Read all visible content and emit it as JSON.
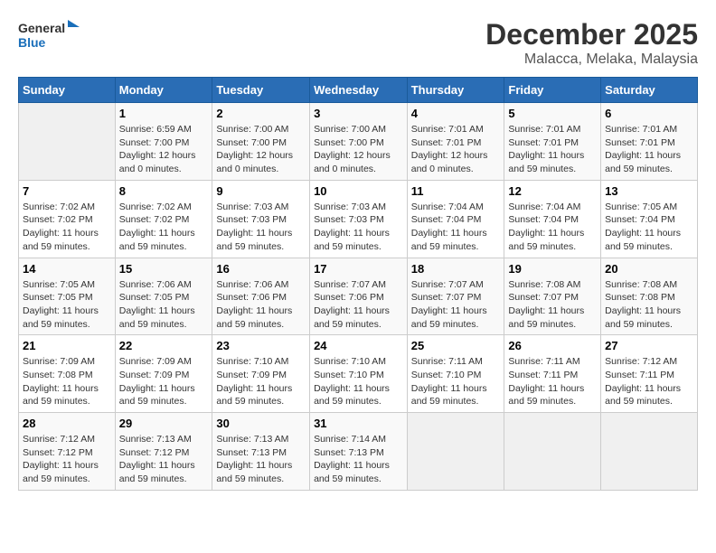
{
  "header": {
    "logo_general": "General",
    "logo_blue": "Blue",
    "title": "December 2025",
    "subtitle": "Malacca, Melaka, Malaysia"
  },
  "days_of_week": [
    "Sunday",
    "Monday",
    "Tuesday",
    "Wednesday",
    "Thursday",
    "Friday",
    "Saturday"
  ],
  "weeks": [
    [
      {
        "day": "",
        "info": ""
      },
      {
        "day": "1",
        "info": "Sunrise: 6:59 AM\nSunset: 7:00 PM\nDaylight: 12 hours\nand 0 minutes."
      },
      {
        "day": "2",
        "info": "Sunrise: 7:00 AM\nSunset: 7:00 PM\nDaylight: 12 hours\nand 0 minutes."
      },
      {
        "day": "3",
        "info": "Sunrise: 7:00 AM\nSunset: 7:00 PM\nDaylight: 12 hours\nand 0 minutes."
      },
      {
        "day": "4",
        "info": "Sunrise: 7:01 AM\nSunset: 7:01 PM\nDaylight: 12 hours\nand 0 minutes."
      },
      {
        "day": "5",
        "info": "Sunrise: 7:01 AM\nSunset: 7:01 PM\nDaylight: 11 hours\nand 59 minutes."
      },
      {
        "day": "6",
        "info": "Sunrise: 7:01 AM\nSunset: 7:01 PM\nDaylight: 11 hours\nand 59 minutes."
      }
    ],
    [
      {
        "day": "7",
        "info": "Sunrise: 7:02 AM\nSunset: 7:02 PM\nDaylight: 11 hours\nand 59 minutes."
      },
      {
        "day": "8",
        "info": "Sunrise: 7:02 AM\nSunset: 7:02 PM\nDaylight: 11 hours\nand 59 minutes."
      },
      {
        "day": "9",
        "info": "Sunrise: 7:03 AM\nSunset: 7:03 PM\nDaylight: 11 hours\nand 59 minutes."
      },
      {
        "day": "10",
        "info": "Sunrise: 7:03 AM\nSunset: 7:03 PM\nDaylight: 11 hours\nand 59 minutes."
      },
      {
        "day": "11",
        "info": "Sunrise: 7:04 AM\nSunset: 7:04 PM\nDaylight: 11 hours\nand 59 minutes."
      },
      {
        "day": "12",
        "info": "Sunrise: 7:04 AM\nSunset: 7:04 PM\nDaylight: 11 hours\nand 59 minutes."
      },
      {
        "day": "13",
        "info": "Sunrise: 7:05 AM\nSunset: 7:04 PM\nDaylight: 11 hours\nand 59 minutes."
      }
    ],
    [
      {
        "day": "14",
        "info": "Sunrise: 7:05 AM\nSunset: 7:05 PM\nDaylight: 11 hours\nand 59 minutes."
      },
      {
        "day": "15",
        "info": "Sunrise: 7:06 AM\nSunset: 7:05 PM\nDaylight: 11 hours\nand 59 minutes."
      },
      {
        "day": "16",
        "info": "Sunrise: 7:06 AM\nSunset: 7:06 PM\nDaylight: 11 hours\nand 59 minutes."
      },
      {
        "day": "17",
        "info": "Sunrise: 7:07 AM\nSunset: 7:06 PM\nDaylight: 11 hours\nand 59 minutes."
      },
      {
        "day": "18",
        "info": "Sunrise: 7:07 AM\nSunset: 7:07 PM\nDaylight: 11 hours\nand 59 minutes."
      },
      {
        "day": "19",
        "info": "Sunrise: 7:08 AM\nSunset: 7:07 PM\nDaylight: 11 hours\nand 59 minutes."
      },
      {
        "day": "20",
        "info": "Sunrise: 7:08 AM\nSunset: 7:08 PM\nDaylight: 11 hours\nand 59 minutes."
      }
    ],
    [
      {
        "day": "21",
        "info": "Sunrise: 7:09 AM\nSunset: 7:08 PM\nDaylight: 11 hours\nand 59 minutes."
      },
      {
        "day": "22",
        "info": "Sunrise: 7:09 AM\nSunset: 7:09 PM\nDaylight: 11 hours\nand 59 minutes."
      },
      {
        "day": "23",
        "info": "Sunrise: 7:10 AM\nSunset: 7:09 PM\nDaylight: 11 hours\nand 59 minutes."
      },
      {
        "day": "24",
        "info": "Sunrise: 7:10 AM\nSunset: 7:10 PM\nDaylight: 11 hours\nand 59 minutes."
      },
      {
        "day": "25",
        "info": "Sunrise: 7:11 AM\nSunset: 7:10 PM\nDaylight: 11 hours\nand 59 minutes."
      },
      {
        "day": "26",
        "info": "Sunrise: 7:11 AM\nSunset: 7:11 PM\nDaylight: 11 hours\nand 59 minutes."
      },
      {
        "day": "27",
        "info": "Sunrise: 7:12 AM\nSunset: 7:11 PM\nDaylight: 11 hours\nand 59 minutes."
      }
    ],
    [
      {
        "day": "28",
        "info": "Sunrise: 7:12 AM\nSunset: 7:12 PM\nDaylight: 11 hours\nand 59 minutes."
      },
      {
        "day": "29",
        "info": "Sunrise: 7:13 AM\nSunset: 7:12 PM\nDaylight: 11 hours\nand 59 minutes."
      },
      {
        "day": "30",
        "info": "Sunrise: 7:13 AM\nSunset: 7:13 PM\nDaylight: 11 hours\nand 59 minutes."
      },
      {
        "day": "31",
        "info": "Sunrise: 7:14 AM\nSunset: 7:13 PM\nDaylight: 11 hours\nand 59 minutes."
      },
      {
        "day": "",
        "info": ""
      },
      {
        "day": "",
        "info": ""
      },
      {
        "day": "",
        "info": ""
      }
    ]
  ]
}
